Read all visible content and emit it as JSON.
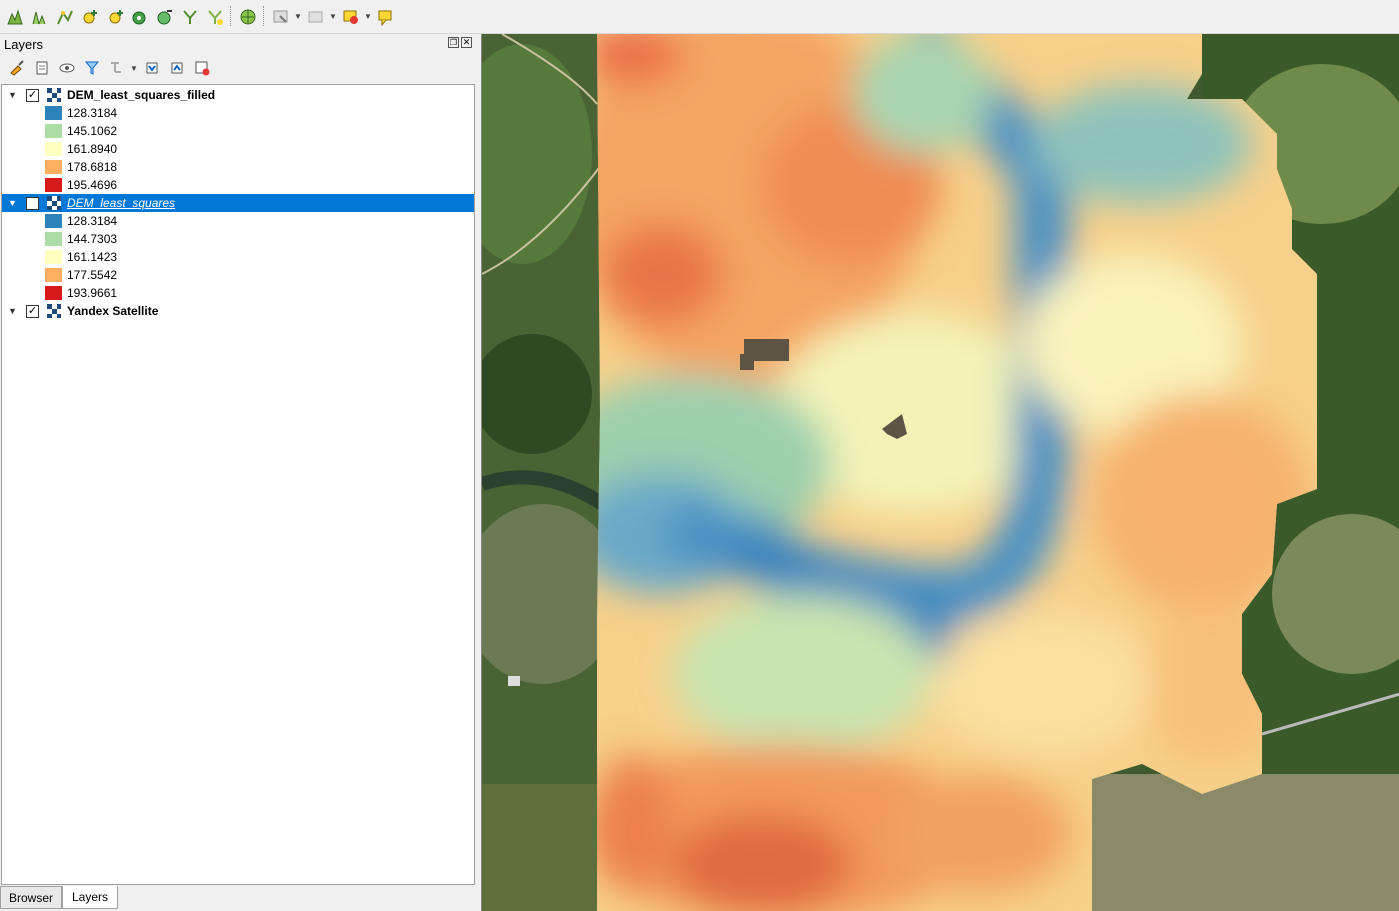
{
  "toolbar": {
    "buttons": [
      "digitize-icon",
      "profile-icon",
      "vertex-icon",
      "add-feature-icon",
      "add-part-icon",
      "add-ring-icon",
      "reshape-icon",
      "split-icon",
      "merge-icon",
      "plugin-icon",
      "select-icon",
      "deselect-icon",
      "identify-icon",
      "annotation-icon"
    ]
  },
  "layers_panel": {
    "title": "Layers",
    "tools": [
      "style-icon",
      "add-group-icon",
      "visibility-icon",
      "filter-icon",
      "filter-legend-icon",
      "expand-all-icon",
      "collapse-all-icon",
      "remove-layer-icon"
    ]
  },
  "layers": [
    {
      "name": "DEM_least_squares_filled",
      "checked": true,
      "selected": false,
      "legend": [
        {
          "value": "128.3184",
          "color": "#2b83ba"
        },
        {
          "value": "145.1062",
          "color": "#abdda4"
        },
        {
          "value": "161.8940",
          "color": "#ffffbf"
        },
        {
          "value": "178.6818",
          "color": "#fdae61"
        },
        {
          "value": "195.4696",
          "color": "#d7191c"
        }
      ]
    },
    {
      "name": "DEM_least_squares",
      "checked": false,
      "selected": true,
      "legend": [
        {
          "value": "128.3184",
          "color": "#2b83ba"
        },
        {
          "value": "144.7303",
          "color": "#abdda4"
        },
        {
          "value": "161.1423",
          "color": "#ffffbf"
        },
        {
          "value": "177.5542",
          "color": "#fdae61"
        },
        {
          "value": "193.9661",
          "color": "#d7191c"
        }
      ]
    },
    {
      "name": "Yandex Satellite",
      "checked": true,
      "selected": false,
      "legend": []
    }
  ],
  "tabs": {
    "browser": "Browser",
    "layers": "Layers"
  },
  "colors": {
    "selection": "#0078d7",
    "dem_low": "#2b83ba",
    "dem_high": "#d7191c"
  }
}
